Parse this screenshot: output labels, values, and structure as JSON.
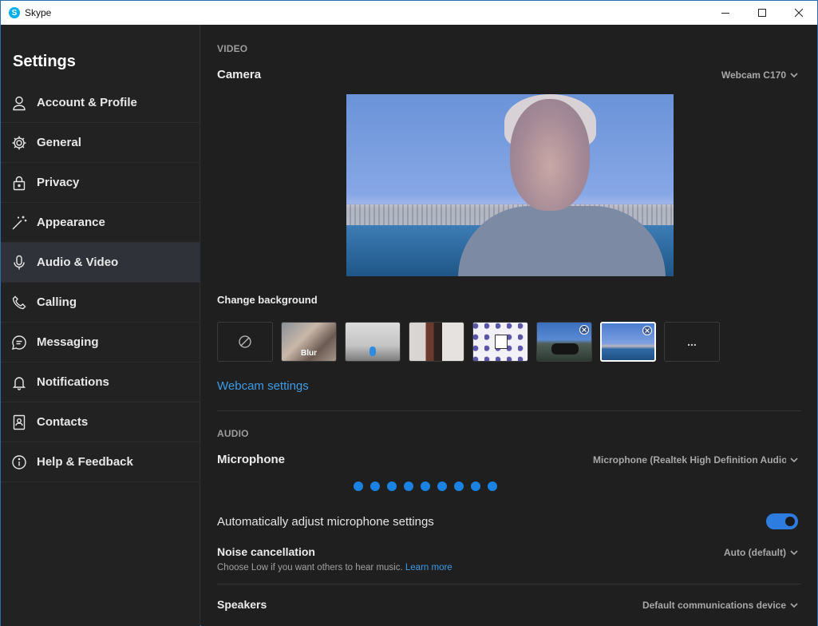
{
  "window": {
    "title": "Skype",
    "app_icon_letter": "S"
  },
  "sidebar": {
    "title": "Settings",
    "items": [
      {
        "label": "Account & Profile",
        "icon": "person-icon",
        "active": false
      },
      {
        "label": "General",
        "icon": "gear-icon",
        "active": false
      },
      {
        "label": "Privacy",
        "icon": "lock-icon",
        "active": false
      },
      {
        "label": "Appearance",
        "icon": "magic-wand-icon",
        "active": false
      },
      {
        "label": "Audio & Video",
        "icon": "microphone-icon",
        "active": true
      },
      {
        "label": "Calling",
        "icon": "phone-icon",
        "active": false
      },
      {
        "label": "Messaging",
        "icon": "chat-bubble-icon",
        "active": false
      },
      {
        "label": "Notifications",
        "icon": "bell-icon",
        "active": false
      },
      {
        "label": "Contacts",
        "icon": "contact-card-icon",
        "active": false
      },
      {
        "label": "Help & Feedback",
        "icon": "info-icon",
        "active": false
      }
    ]
  },
  "video": {
    "section_title": "VIDEO",
    "camera_label": "Camera",
    "camera_device": "Webcam C170",
    "change_background_label": "Change background",
    "backgrounds": [
      {
        "name": "none",
        "label": ""
      },
      {
        "name": "blur",
        "label": "Blur"
      },
      {
        "name": "office",
        "label": ""
      },
      {
        "name": "room",
        "label": ""
      },
      {
        "name": "pattern",
        "label": ""
      },
      {
        "name": "motorcycle",
        "label": "",
        "removable": true
      },
      {
        "name": "sea",
        "label": "",
        "removable": true,
        "selected": true
      },
      {
        "name": "more",
        "label": "..."
      }
    ],
    "webcam_settings_link": "Webcam settings"
  },
  "audio": {
    "section_title": "AUDIO",
    "microphone_label": "Microphone",
    "microphone_device": "Microphone (Realtek High Definition Audio",
    "mic_level_dots": 9,
    "auto_adjust_label": "Automatically adjust microphone settings",
    "auto_adjust_enabled": true,
    "noise_cancellation_label": "Noise cancellation",
    "noise_cancellation_value": "Auto (default)",
    "noise_hint": "Choose Low if you want others to hear music.",
    "learn_more_link": "Learn more",
    "speakers_label": "Speakers",
    "speakers_device": "Default communications device"
  },
  "colors": {
    "accent": "#1a82e2",
    "link": "#3d9be9",
    "sidebar_active": "#2f3238",
    "background": "#1f1f1f"
  }
}
